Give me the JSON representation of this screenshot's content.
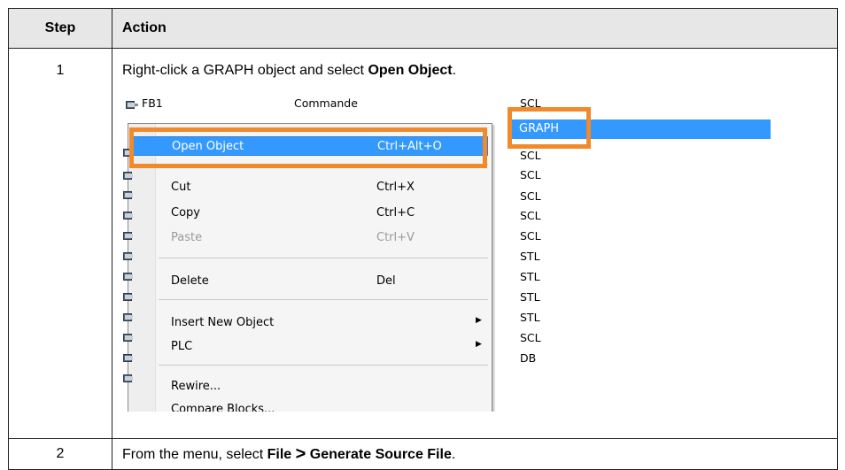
{
  "table": {
    "headers": {
      "step": "Step",
      "action": "Action"
    },
    "rows": [
      {
        "step": "1",
        "text_before": "Right-click a GRAPH object and select ",
        "bold": "Open Object",
        "text_after": "."
      },
      {
        "step": "2",
        "text_before": "From the menu, select ",
        "bold1": "File",
        "arrow": ">",
        "bold2": "Generate Source File",
        "text_after": "."
      }
    ]
  },
  "screenshot": {
    "objects": [
      {
        "name": "FB1",
        "comment": "Commande",
        "lang": "SCL"
      },
      {
        "lang": "GRAPH"
      },
      {
        "lang": "SCL"
      },
      {
        "lang": "SCL"
      },
      {
        "lang": "SCL"
      },
      {
        "lang": "SCL"
      },
      {
        "lang": "SCL"
      },
      {
        "lang": "STL"
      },
      {
        "lang": "STL"
      },
      {
        "lang": "STL"
      },
      {
        "lang": "STL"
      },
      {
        "lang": "SCL"
      },
      {
        "lang": "DB"
      }
    ],
    "context_menu": {
      "open_object": {
        "label": "Open Object",
        "shortcut": "Ctrl+Alt+O"
      },
      "cut": {
        "label": "Cut",
        "shortcut": "Ctrl+X"
      },
      "copy": {
        "label": "Copy",
        "shortcut": "Ctrl+C"
      },
      "paste": {
        "label": "Paste",
        "shortcut": "Ctrl+V"
      },
      "delete": {
        "label": "Delete",
        "shortcut": "Del"
      },
      "insert_new_object": {
        "label": "Insert New Object"
      },
      "plc": {
        "label": "PLC"
      },
      "rewire": {
        "label": "Rewire..."
      },
      "compare_blocks": {
        "label": "Compare Blocks..."
      }
    }
  },
  "colors": {
    "highlight_box": "#f08a2b",
    "selection": "#3399ff",
    "header_bg": "#e7e7e7"
  }
}
